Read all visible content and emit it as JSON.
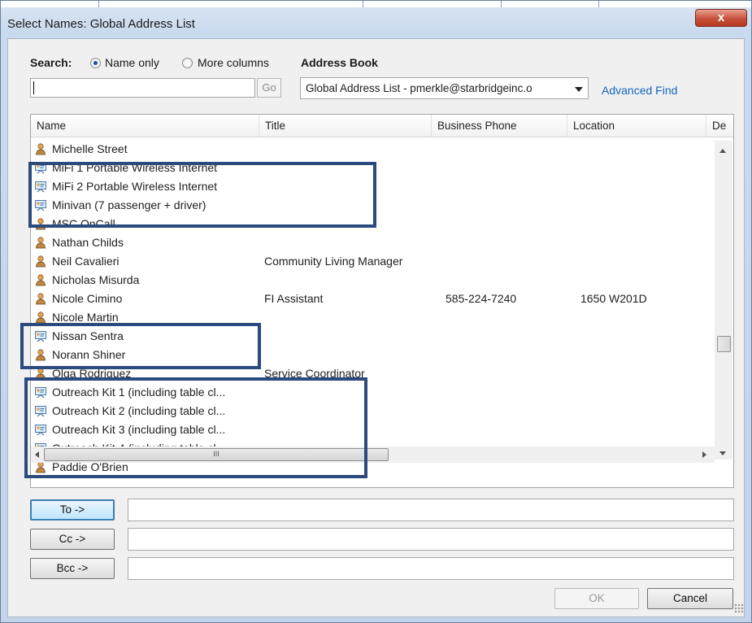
{
  "window": {
    "title": "Select Names: Global Address List",
    "close_glyph": "x"
  },
  "search": {
    "label": "Search:",
    "option_name_only": "Name only",
    "option_more_columns": "More columns",
    "selected_option": "Name only",
    "value": "",
    "go_label": "Go"
  },
  "address_book": {
    "label": "Address Book",
    "selected": "Global Address List - pmerkle@starbridgeinc.o",
    "advanced_find": "Advanced Find"
  },
  "columns": [
    "Name",
    "Title",
    "Business Phone",
    "Location",
    "De"
  ],
  "rows": [
    {
      "type": "person",
      "name": "Michelle Street",
      "title": "",
      "phone": "",
      "location": ""
    },
    {
      "type": "resource",
      "name": "MiFi 1 Portable Wireless Internet",
      "title": "",
      "phone": "",
      "location": ""
    },
    {
      "type": "resource",
      "name": "MiFi 2 Portable Wireless Internet",
      "title": "",
      "phone": "",
      "location": ""
    },
    {
      "type": "resource",
      "name": "Minivan (7 passenger + driver)",
      "title": "",
      "phone": "",
      "location": ""
    },
    {
      "type": "person",
      "name": "MSC OnCall",
      "title": "",
      "phone": "",
      "location": ""
    },
    {
      "type": "person",
      "name": "Nathan Childs",
      "title": "",
      "phone": "",
      "location": ""
    },
    {
      "type": "person",
      "name": "Neil Cavalieri",
      "title": "Community Living Manager",
      "phone": "",
      "location": ""
    },
    {
      "type": "person",
      "name": "Nicholas Misurda",
      "title": "",
      "phone": "",
      "location": ""
    },
    {
      "type": "person",
      "name": "Nicole Cimino",
      "title": "FI Assistant",
      "phone": "585-224-7240",
      "location": "1650 W201D"
    },
    {
      "type": "person",
      "name": "Nicole Martin",
      "title": "",
      "phone": "",
      "location": ""
    },
    {
      "type": "resource",
      "name": "Nissan Sentra",
      "title": "",
      "phone": "",
      "location": ""
    },
    {
      "type": "person",
      "name": "Norann Shiner",
      "title": "",
      "phone": "",
      "location": ""
    },
    {
      "type": "person",
      "name": "Olga Rodriguez",
      "title": "Service Coordinator",
      "phone": "",
      "location": ""
    },
    {
      "type": "resource",
      "name": "Outreach Kit 1 (including table cl...",
      "title": "",
      "phone": "",
      "location": ""
    },
    {
      "type": "resource",
      "name": "Outreach Kit 2 (including table cl...",
      "title": "",
      "phone": "",
      "location": ""
    },
    {
      "type": "resource",
      "name": "Outreach Kit 3 (including table cl...",
      "title": "",
      "phone": "",
      "location": ""
    },
    {
      "type": "resource",
      "name": "Outreach Kit 4 (including table cl...",
      "title": "",
      "phone": "",
      "location": ""
    },
    {
      "type": "person",
      "name": "Paddie O'Brien",
      "title": "",
      "phone": "",
      "location": ""
    }
  ],
  "hscroll_thumb_label": "III",
  "recipients": {
    "to_label": "To ->",
    "cc_label": "Cc ->",
    "bcc_label": "Bcc ->",
    "to_value": "",
    "cc_value": "",
    "bcc_value": ""
  },
  "footer": {
    "ok_label": "OK",
    "cancel_label": "Cancel"
  },
  "icons": {
    "person": "person-contact-icon",
    "resource": "resource-room-icon"
  },
  "colors": {
    "highlight_box": "#2b4a7d",
    "link": "#1565c0",
    "close_button": "#c7503b"
  }
}
